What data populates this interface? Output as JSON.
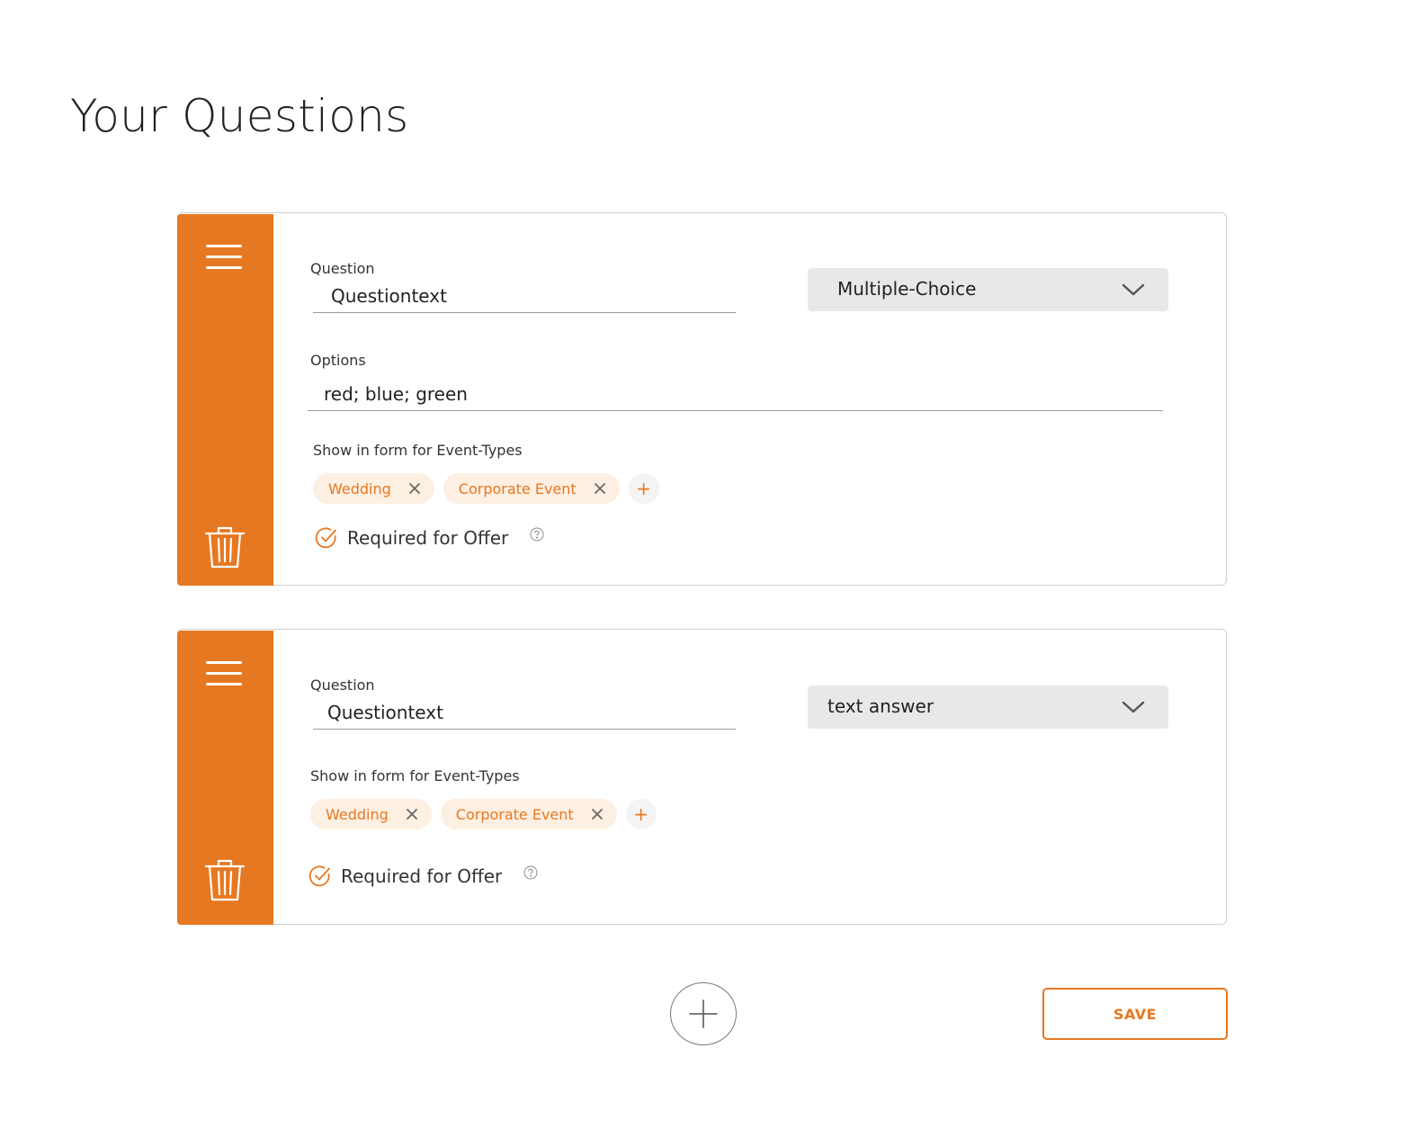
{
  "page": {
    "title": "Your Questions"
  },
  "colors": {
    "accent": "#e67821",
    "chip_background": "#fdefe2",
    "select_background": "#e8e8e8"
  },
  "questions": [
    {
      "question_label": "Question",
      "question_value": "Questiontext",
      "answer_type": "Multiple-Choice",
      "options_label": "Options",
      "options_value": "red; blue; green",
      "event_types_label": "Show in form for Event-Types",
      "event_types": [
        "Wedding",
        "Corporate Event"
      ],
      "add_event_type": "+",
      "required_label": "Required for Offer",
      "required_checked": true
    },
    {
      "question_label": "Question",
      "question_value": "Questiontext",
      "answer_type": "text answer",
      "event_types_label": "Show in form for Event-Types",
      "event_types": [
        "Wedding",
        "Corporate Event"
      ],
      "add_event_type": "+",
      "required_label": "Required for Offer",
      "required_checked": true
    }
  ],
  "actions": {
    "save_label": "SAVE"
  },
  "icons": {
    "drag": "drag-handle-icon",
    "delete": "trash-icon",
    "dropdown": "chevron-down-icon",
    "remove": "close-icon",
    "check": "check-circle-icon",
    "help": "help-icon",
    "add": "plus-circle-icon"
  }
}
